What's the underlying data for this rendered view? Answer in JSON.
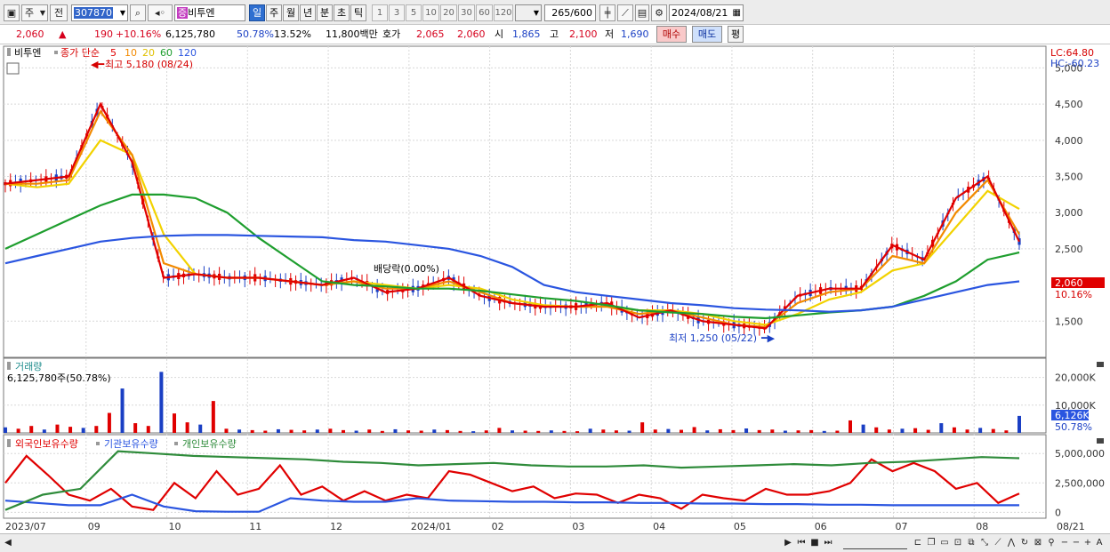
{
  "toolbar": {
    "market_label": "주",
    "prev_label": "전",
    "code": "307870",
    "name": "비투엔",
    "name_badge": "증",
    "period_tabs": [
      "일",
      "주",
      "월",
      "년",
      "분",
      "초",
      "틱"
    ],
    "minute_options": [
      "1",
      "3",
      "5",
      "10",
      "20",
      "30",
      "60",
      "120"
    ],
    "count_display": "265",
    "count_max": "/600",
    "date": "2024/08/21"
  },
  "quote": {
    "price": "2,060",
    "change": "190",
    "change_pct": "+10.16%",
    "volume": "6,125,780",
    "volume_ratio": "50.78%",
    "turnover": "13.52%",
    "amount": "11,800백만",
    "bid_label": "호가",
    "ask": "2,065",
    "bid": "2,060",
    "open_label": "시",
    "open": "1,865",
    "high_label": "고",
    "high": "2,100",
    "low_label": "저",
    "low": "1,690",
    "buy_label": "매수",
    "sell_label": "매도",
    "flat_label": "평"
  },
  "legend": {
    "name": "비투엔",
    "series_label": "종가 단순",
    "ma": [
      "5",
      "10",
      "20",
      "60",
      "120"
    ],
    "high_note": "최고 5,180 (08/24)",
    "low_note": "최저 1,250 (05/22)",
    "dividend_note": "배당락(0.00%)",
    "lc": "LC:64.80",
    "hc": "HC:-60.23",
    "current_price_tag": "2,060",
    "current_pct_tag": "10.16%",
    "volume_title": "거래량",
    "volume_value": "6,125,780주(50.78%)",
    "volume_tag": "6,126K",
    "volume_pct_tag": "50.78%",
    "holdings_series": [
      "외국인보유수량",
      "기관보유수량",
      "개인보유수량"
    ]
  },
  "colors": {
    "ma5": "#e00000",
    "ma10": "#f28a00",
    "ma20": "#f2d200",
    "ma60": "#1e9e2e",
    "ma120": "#2a55e0",
    "up": "#e00000",
    "down": "#1a3fc4",
    "foreign": "#e00000",
    "institution": "#2a55e0",
    "individual": "#2e8b3a"
  },
  "chart_data": [
    {
      "type": "line",
      "title": "비투엔 종가 단순",
      "ylim": [
        1000,
        5300
      ],
      "y_ticks": [
        "5,000",
        "4,500",
        "4,000",
        "3,500",
        "3,000",
        "2,500",
        "1,500"
      ],
      "x_ticks": [
        "2023/07",
        "09",
        "10",
        "11",
        "12",
        "2024/01",
        "02",
        "03",
        "04",
        "05",
        "06",
        "07",
        "08",
        "08/21"
      ],
      "series": [
        {
          "name": "5",
          "values": [
            3400,
            3450,
            3500,
            4500,
            3700,
            2100,
            2150,
            2100,
            2100,
            2050,
            2000,
            2100,
            1900,
            1950,
            2100,
            1850,
            1750,
            1700,
            1700,
            1750,
            1550,
            1650,
            1500,
            1450,
            1400,
            1850,
            1950,
            1950,
            2550,
            2350,
            3200,
            3500,
            2600
          ]
        },
        {
          "name": "10",
          "values": [
            3400,
            3400,
            3450,
            4400,
            3800,
            2300,
            2150,
            2100,
            2100,
            2050,
            2000,
            2050,
            1950,
            1950,
            2050,
            1900,
            1750,
            1700,
            1700,
            1700,
            1600,
            1650,
            1550,
            1450,
            1420,
            1750,
            1900,
            1950,
            2400,
            2300,
            3000,
            3450,
            2700
          ]
        },
        {
          "name": "20",
          "values": [
            3400,
            3350,
            3400,
            4000,
            3800,
            2700,
            2150,
            2100,
            2100,
            2050,
            2000,
            2050,
            2000,
            1950,
            2000,
            1950,
            1800,
            1720,
            1700,
            1700,
            1650,
            1650,
            1600,
            1500,
            1450,
            1600,
            1800,
            1900,
            2200,
            2300,
            2800,
            3300,
            3050
          ]
        },
        {
          "name": "60",
          "values": [
            2500,
            2700,
            2900,
            3100,
            3250,
            3250,
            3200,
            3000,
            2650,
            2350,
            2050,
            2000,
            1980,
            1950,
            1950,
            1920,
            1870,
            1820,
            1780,
            1720,
            1650,
            1620,
            1600,
            1560,
            1540,
            1580,
            1620,
            1650,
            1700,
            1850,
            2050,
            2350,
            2450
          ]
        },
        {
          "name": "120",
          "values": [
            2300,
            2400,
            2500,
            2600,
            2650,
            2680,
            2690,
            2690,
            2680,
            2670,
            2660,
            2620,
            2600,
            2550,
            2500,
            2400,
            2250,
            2000,
            1900,
            1850,
            1800,
            1750,
            1720,
            1680,
            1660,
            1650,
            1630,
            1650,
            1700,
            1800,
            1900,
            2000,
            2050
          ]
        }
      ]
    },
    {
      "type": "bar",
      "title": "거래량",
      "ylim": [
        0,
        25000
      ],
      "y_ticks": [
        "20,000K",
        "10,000K"
      ],
      "values": [
        2000,
        1500,
        2500,
        1200,
        3000,
        2200,
        1800,
        2500,
        7200,
        16000,
        3500,
        2500,
        22000,
        7000,
        3800,
        3000,
        11500,
        1500,
        1200,
        1000,
        800,
        1300,
        1100,
        900,
        1200,
        1500,
        1000,
        800,
        1200,
        700,
        1300,
        900,
        800,
        1200,
        1000,
        700,
        600,
        900,
        1800,
        900,
        800,
        700,
        900,
        700,
        600,
        1500,
        1200,
        900,
        800,
        3800,
        1200,
        1400,
        1100,
        2100,
        900,
        1300,
        1000,
        1600,
        1000,
        1200,
        800,
        900,
        1000,
        700,
        800,
        4500,
        3000,
        2000,
        1200,
        1500,
        1700,
        1100,
        3500,
        2000,
        1200,
        1800,
        1400,
        900,
        6125
      ]
    },
    {
      "type": "line",
      "title": "외국인보유수량",
      "ylim": [
        -500000,
        6000000
      ],
      "y_ticks": [
        "5,000,000",
        "2,500,000",
        "0"
      ],
      "series": [
        {
          "name": "외국인보유수량",
          "values": [
            2500000,
            4800000,
            3200000,
            1500000,
            1000000,
            2000000,
            500000,
            200000,
            2500000,
            1200000,
            3500000,
            1500000,
            2000000,
            4000000,
            1500000,
            2200000,
            1000000,
            1800000,
            1000000,
            1500000,
            1200000,
            3500000,
            3200000,
            2500000,
            1800000,
            2200000,
            1200000,
            1600000,
            1500000,
            800000,
            1500000,
            1200000,
            300000,
            1500000,
            1200000,
            1000000,
            2000000,
            1500000,
            1500000,
            1800000,
            2500000,
            4500000,
            3500000,
            4200000,
            3500000,
            2000000,
            2500000,
            800000,
            1600000
          ]
        },
        {
          "name": "기관보유수량",
          "values": [
            1000000,
            800000,
            600000,
            600000,
            1500000,
            500000,
            100000,
            50000,
            50000,
            1200000,
            1000000,
            900000,
            900000,
            1200000,
            1000000,
            950000,
            900000,
            900000,
            850000,
            850000,
            800000,
            800000,
            750000,
            750000,
            700000,
            700000,
            650000,
            650000,
            600000,
            600000,
            600000,
            600000,
            600000
          ]
        },
        {
          "name": "개인보유수량",
          "values": [
            200000,
            1500000,
            2000000,
            5200000,
            5000000,
            4800000,
            4700000,
            4600000,
            4500000,
            4300000,
            4200000,
            4000000,
            4100000,
            4200000,
            4000000,
            3900000,
            3900000,
            4000000,
            3800000,
            3900000,
            4000000,
            4100000,
            4000000,
            4200000,
            4300000,
            4500000,
            4700000,
            4600000
          ]
        }
      ]
    }
  ],
  "bottom": {
    "zoom_label": "A"
  }
}
